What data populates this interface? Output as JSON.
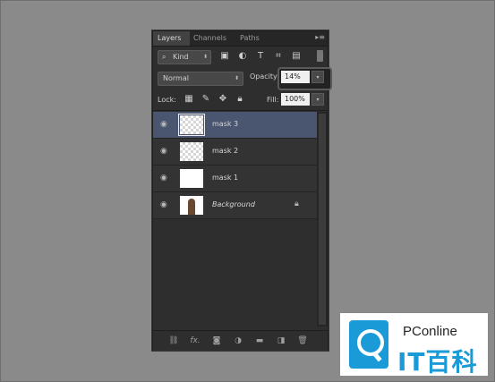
{
  "tabs": [
    {
      "label": "Layers"
    },
    {
      "label": "Channels"
    },
    {
      "label": "Paths"
    }
  ],
  "filter": {
    "kind_label": "Kind"
  },
  "blend_mode": "Normal",
  "opacity": {
    "label": "Opacity:",
    "value": "14%"
  },
  "lock": {
    "label": "Lock:"
  },
  "fill": {
    "label": "Fill:",
    "value": "100%"
  },
  "layers": [
    {
      "name": "mask 3",
      "selected": true,
      "thumbnail": "transparent-checker"
    },
    {
      "name": "mask 2",
      "selected": false,
      "thumbnail": "transparent-checker"
    },
    {
      "name": "mask 1",
      "selected": false,
      "thumbnail": "white"
    },
    {
      "name": "Background",
      "selected": false,
      "thumbnail": "portrait-photo",
      "locked": true
    }
  ],
  "bottom_toolbar": {
    "icons": [
      "link-layers-icon",
      "fx-icon",
      "add-mask-icon",
      "adjustment-layer-icon",
      "new-group-icon",
      "new-layer-icon",
      "delete-layer-icon"
    ],
    "fx_label": "fx."
  },
  "watermark": {
    "brand_top": "PConline",
    "brand_bottom": "IT百科",
    "accent": "#1a9ad7"
  }
}
